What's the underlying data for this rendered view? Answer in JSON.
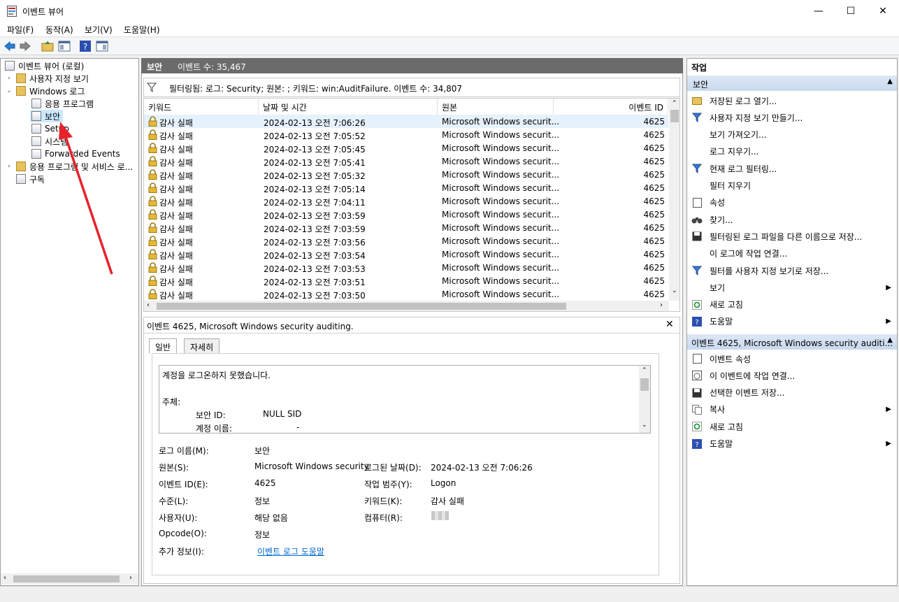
{
  "window": {
    "title": "이벤트 뷰어",
    "minimize": "—",
    "maximize": "☐",
    "close": "✕"
  },
  "menu": [
    "파일(F)",
    "동작(A)",
    "보기(V)",
    "도움말(H)"
  ],
  "tree": {
    "root": "이벤트 뷰어 (로컬)",
    "custom_views": "사용자 지정 보기",
    "windows_logs": "Windows 로그",
    "logs": [
      "응용 프로그램",
      "보안",
      "Setup",
      "시스템",
      "Forwarded Events"
    ],
    "app_services": "응용 프로그램 및 서비스 로...",
    "subscriptions": "구독"
  },
  "center": {
    "header_title": "보안",
    "header_count": "이벤트 수: 35,467",
    "filter_text": "필터링됨: 로그: Security; 원본: ; 키워드: win:AuditFailure. 이벤트 수: 34,807",
    "columns": [
      "키워드",
      "날짜 및 시간",
      "원본",
      "이벤트 ID"
    ],
    "rows": [
      {
        "keyword": "감사 실패",
        "datetime": "2024-02-13 오전 7:06:26",
        "source": "Microsoft Windows securit...",
        "id": "4625"
      },
      {
        "keyword": "감사 실패",
        "datetime": "2024-02-13 오전 7:05:52",
        "source": "Microsoft Windows securit...",
        "id": "4625"
      },
      {
        "keyword": "감사 실패",
        "datetime": "2024-02-13 오전 7:05:45",
        "source": "Microsoft Windows securit...",
        "id": "4625"
      },
      {
        "keyword": "감사 실패",
        "datetime": "2024-02-13 오전 7:05:41",
        "source": "Microsoft Windows securit...",
        "id": "4625"
      },
      {
        "keyword": "감사 실패",
        "datetime": "2024-02-13 오전 7:05:32",
        "source": "Microsoft Windows securit...",
        "id": "4625"
      },
      {
        "keyword": "감사 실패",
        "datetime": "2024-02-13 오전 7:05:14",
        "source": "Microsoft Windows securit...",
        "id": "4625"
      },
      {
        "keyword": "감사 실패",
        "datetime": "2024-02-13 오전 7:04:11",
        "source": "Microsoft Windows securit...",
        "id": "4625"
      },
      {
        "keyword": "감사 실패",
        "datetime": "2024-02-13 오전 7:03:59",
        "source": "Microsoft Windows securit...",
        "id": "4625"
      },
      {
        "keyword": "감사 실패",
        "datetime": "2024-02-13 오전 7:03:59",
        "source": "Microsoft Windows securit...",
        "id": "4625"
      },
      {
        "keyword": "감사 실패",
        "datetime": "2024-02-13 오전 7:03:56",
        "source": "Microsoft Windows securit...",
        "id": "4625"
      },
      {
        "keyword": "감사 실패",
        "datetime": "2024-02-13 오전 7:03:54",
        "source": "Microsoft Windows securit...",
        "id": "4625"
      },
      {
        "keyword": "감사 실패",
        "datetime": "2024-02-13 오전 7:03:53",
        "source": "Microsoft Windows securit...",
        "id": "4625"
      },
      {
        "keyword": "감사 실패",
        "datetime": "2024-02-13 오전 7:03:51",
        "source": "Microsoft Windows securit...",
        "id": "4625"
      },
      {
        "keyword": "감사 실패",
        "datetime": "2024-02-13 오전 7:03:50",
        "source": "Microsoft Windows securit...",
        "id": "4625"
      }
    ]
  },
  "detail": {
    "title": "이벤트 4625, Microsoft Windows security auditing.",
    "tabs": [
      "일반",
      "자세히"
    ],
    "desc_line1": "계정을 로그온하지 못했습니다.",
    "desc_subject": "주체:",
    "desc_sid_label": "보안 ID:",
    "desc_sid_value": "NULL SID",
    "desc_acct_label": "계정 이름:",
    "desc_acct_value": "-",
    "fields": {
      "log_name_label": "로그 이름(M):",
      "log_name": "보안",
      "source_label": "원본(S):",
      "source": "Microsoft Windows security",
      "logged_label": "로그된 날짜(D):",
      "logged": "2024-02-13 오전 7:06:26",
      "event_id_label": "이벤트 ID(E):",
      "event_id": "4625",
      "task_label": "작업 범주(Y):",
      "task": "Logon",
      "level_label": "수준(L):",
      "level": "정보",
      "keywords_label": "키워드(K):",
      "keywords": "감사 실패",
      "user_label": "사용자(U):",
      "user": "해당 없음",
      "computer_label": "컴퓨터(R):",
      "opcode_label": "Opcode(O):",
      "opcode": "정보",
      "more_label": "추가 정보(I):",
      "more_link": "이벤트 로그 도움말"
    }
  },
  "actions": {
    "header": "작업",
    "group1": "보안",
    "group1_items": [
      {
        "label": "저장된 로그 열기...",
        "icon": "folder-open-icon"
      },
      {
        "label": "사용자 지정 보기 만들기...",
        "icon": "filter-icon"
      },
      {
        "label": "보기 가져오기...",
        "icon": ""
      },
      {
        "label": "로그 지우기...",
        "icon": ""
      },
      {
        "label": "현재 로그 필터링...",
        "icon": "filter-icon"
      },
      {
        "label": "필터 지우기",
        "icon": ""
      },
      {
        "label": "속성",
        "icon": "properties-icon"
      },
      {
        "label": "찾기...",
        "icon": "binoculars-icon"
      },
      {
        "label": "필터링된 로그 파일을 다른 이름으로 저장...",
        "icon": "save-icon"
      },
      {
        "label": "이 로그에 작업 연결...",
        "icon": ""
      },
      {
        "label": "필터를 사용자 지정 보기로 저장...",
        "icon": "filter-save-icon"
      },
      {
        "label": "보기",
        "icon": ""
      },
      {
        "label": "새로 고침",
        "icon": "refresh-icon"
      },
      {
        "label": "도움말",
        "icon": "help-icon"
      }
    ],
    "group2": "이벤트 4625, Microsoft Windows security auditi...",
    "group2_items": [
      {
        "label": "이벤트 속성",
        "icon": "properties-icon"
      },
      {
        "label": "이 이벤트에 작업 연결...",
        "icon": "task-icon"
      },
      {
        "label": "선택한 이벤트 저장...",
        "icon": "save-icon"
      },
      {
        "label": "복사",
        "icon": "copy-icon"
      },
      {
        "label": "새로 고침",
        "icon": "refresh-icon"
      },
      {
        "label": "도움말",
        "icon": "help-icon"
      }
    ]
  },
  "colors": {
    "accent": "#0066cc",
    "annotation_arrow": "#e8212b",
    "header_gray": "#6b6b6b"
  }
}
